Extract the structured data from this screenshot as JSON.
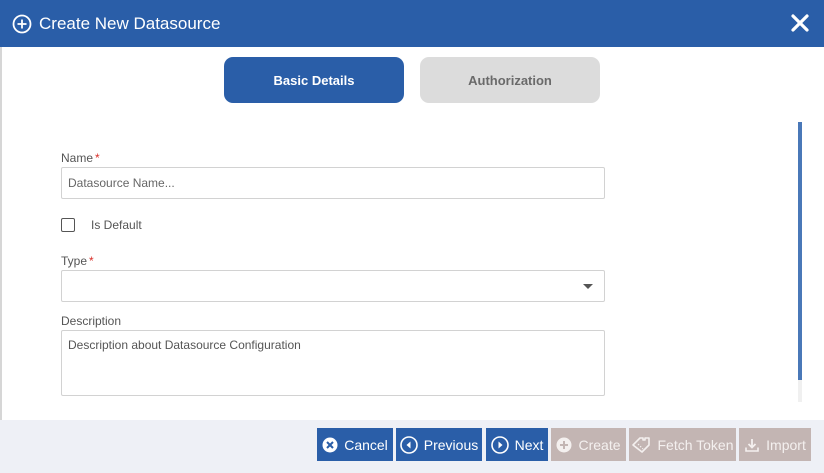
{
  "dialog": {
    "title": "Create New Datasource",
    "title_icon": "plus-circle-icon",
    "close_icon": "close-icon"
  },
  "tabs": [
    {
      "label": "Basic Details",
      "active": true
    },
    {
      "label": "Authorization",
      "active": false
    }
  ],
  "form": {
    "name": {
      "label": "Name",
      "required_mark": "*",
      "placeholder": "Datasource Name...",
      "value": ""
    },
    "is_default": {
      "label": "Is Default",
      "checked": false
    },
    "type": {
      "label": "Type",
      "required_mark": "*",
      "value": ""
    },
    "description": {
      "label": "Description",
      "placeholder": "Description about Datasource Configuration",
      "value": ""
    }
  },
  "footer": {
    "buttons": [
      {
        "label": "Cancel",
        "icon": "x-circle-icon",
        "enabled": true
      },
      {
        "label": "Previous",
        "icon": "chevron-left-circle-icon",
        "enabled": true
      },
      {
        "label": "Next",
        "icon": "chevron-right-circle-icon",
        "enabled": true
      },
      {
        "label": "Create",
        "icon": "plus-circle-icon",
        "enabled": false
      },
      {
        "label": "Fetch Token",
        "icon": "ticket-icon",
        "enabled": false
      },
      {
        "label": "Import",
        "icon": "download-icon",
        "enabled": false
      }
    ]
  },
  "colors": {
    "primary": "#2a5ea8",
    "disabled": "#c3b5b3",
    "inactive_tab": "#dcdcdc",
    "required": "#d9302a",
    "footer_bg": "#eef0f6"
  }
}
